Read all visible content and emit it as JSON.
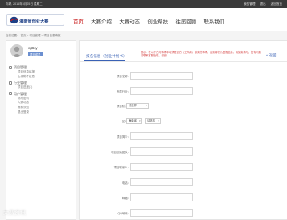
{
  "topbar": {
    "welcome": "你好,    2016年5月25日 星期二",
    "links": [
      "我的管理",
      "退出",
      "返回首页"
    ]
  },
  "header": {
    "logo_text": "海南省创业大赛",
    "nav": [
      "首页",
      "大赛介绍",
      "大赛动态",
      "创业帮扶",
      "往届回顾",
      "联系我们"
    ],
    "active_index": 0
  },
  "breadcrumb": "当前位置：  首页  >  项目管理  >  项目信息填报",
  "sidebar": {
    "username": "cgBoy",
    "badge": "项目成员",
    "groups": [
      {
        "title": "项目管理",
        "items": [
          "项目信息填报",
          "上传附件信息"
        ]
      },
      {
        "title": "行业管理",
        "items": [
          "项目进度(1)"
        ]
      },
      {
        "title": "用户管理",
        "items": [
          "修改密码",
          "大赛动态",
          "赛前须知",
          "退出登录"
        ]
      }
    ]
  },
  "main": {
    "tab_label": "报名信息（创业计划书）",
    "notice": "提示：在以下任何事项中均须是官方（工商局）核实的事项，否则将视为虚假信息，请如实填写；如有问题请联系客服处理，谢谢！",
    "back_label": "« 返回",
    "fields": [
      {
        "label": "项目名称：",
        "type": "input"
      },
      {
        "label": "所属行业：",
        "type": "input"
      },
      {
        "label": "项目阶段：",
        "type": "select",
        "options": [
          "请选择"
        ]
      },
      {
        "label": "区域：",
        "type": "select2",
        "options": [
          "海南省",
          "请选择"
        ]
      },
      {
        "label": "项目简介：",
        "type": "input"
      },
      {
        "label": "项目创始团队：",
        "type": "input"
      },
      {
        "label": "项目联系人：",
        "type": "input"
      },
      {
        "label": "电话：",
        "type": "input"
      },
      {
        "label": "邮箱：",
        "type": "input"
      },
      {
        "label": "QQ号码：",
        "type": "input"
      }
    ]
  },
  "watermark": "大赛资讯"
}
